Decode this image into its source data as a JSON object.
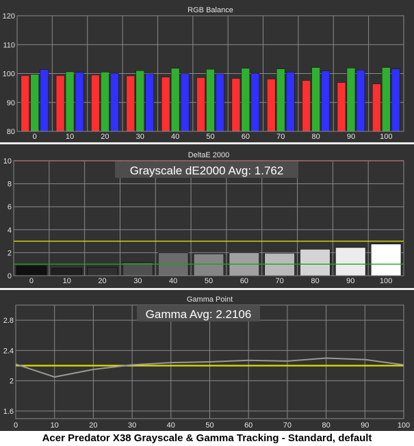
{
  "caption": "Acer Predator X38 Grayscale & Gamma Tracking - Standard, default",
  "chart_data": [
    {
      "type": "bar",
      "title": "RGB Balance",
      "categories": [
        "0",
        "10",
        "20",
        "30",
        "40",
        "50",
        "60",
        "70",
        "80",
        "90",
        "100"
      ],
      "ylim": [
        80,
        120
      ],
      "yticks": [
        "120",
        "110",
        "100",
        "90",
        "80"
      ],
      "grid": true,
      "series": [
        {
          "color": "#ff3030",
          "values": [
            99.3,
            99.3,
            99.5,
            99.2,
            98.8,
            98.6,
            98.3,
            98.1,
            97.6,
            96.9,
            96.4
          ]
        },
        {
          "color": "#30b030",
          "values": [
            99.7,
            100.6,
            100.5,
            101.0,
            101.8,
            101.5,
            101.8,
            101.6,
            102.1,
            101.9,
            102.1
          ]
        },
        {
          "color": "#3030ff",
          "values": [
            101.4,
            100.4,
            100.1,
            99.9,
            100.0,
            99.9,
            100.1,
            100.5,
            100.9,
            101.2,
            101.6
          ]
        }
      ]
    },
    {
      "type": "bar",
      "title": "DeltaE 2000",
      "annotation": "Grayscale dE2000 Avg: 1.762",
      "categories": [
        "0",
        "10",
        "20",
        "30",
        "40",
        "50",
        "60",
        "70",
        "80",
        "90",
        "100"
      ],
      "ylim": [
        0,
        10
      ],
      "yticks": [
        "10",
        "8",
        "6",
        "4",
        "2",
        "0"
      ],
      "grid": true,
      "values": [
        0.85,
        0.65,
        0.75,
        1.15,
        2.0,
        1.9,
        2.0,
        1.95,
        2.3,
        2.45,
        2.75
      ],
      "bar_colors": [
        "#101010",
        "#202020",
        "#303030",
        "#505050",
        "#6c6c6c",
        "#858585",
        "#a0a0a0",
        "#bababa",
        "#d4d4d4",
        "#ececec",
        "#ffffff"
      ],
      "reference_lines": [
        {
          "value": 10,
          "color": "#e03030"
        },
        {
          "value": 3,
          "color": "#e0e000"
        },
        {
          "value": 1,
          "color": "#20a020"
        }
      ]
    },
    {
      "type": "line",
      "title": "Gamma Point",
      "annotation": "Gamma Avg: 2.2106",
      "x": [
        0,
        10,
        20,
        30,
        40,
        50,
        60,
        70,
        80,
        90,
        100
      ],
      "xticks": [
        "0",
        "10",
        "20",
        "30",
        "40",
        "50",
        "60",
        "70",
        "80",
        "90",
        "100"
      ],
      "ylim": [
        1.5,
        3.0
      ],
      "yticks": [
        "2.8",
        "2.4",
        "2",
        "1.6"
      ],
      "grid": true,
      "values": [
        2.22,
        2.05,
        2.15,
        2.21,
        2.24,
        2.25,
        2.27,
        2.26,
        2.3,
        2.28,
        2.21
      ],
      "line_color": "#9a9a9a",
      "reference_value": 2.2,
      "reference_color": "#e0e000"
    }
  ]
}
